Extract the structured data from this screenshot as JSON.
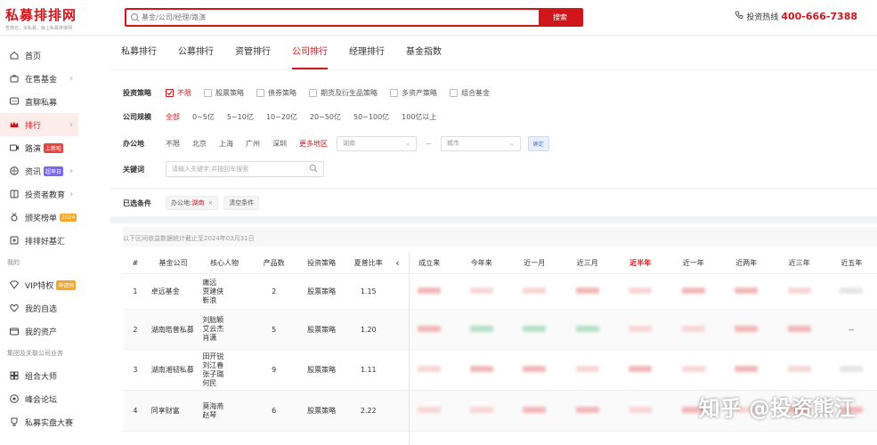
{
  "brand": {
    "title": "私募排排网",
    "subtitle": "查排名，买私募，就上私募排排网"
  },
  "search": {
    "placeholder": "基金/公司/经理/路演",
    "button": "搜索"
  },
  "hotline": {
    "label": "投资热线",
    "number": "400-666-7388"
  },
  "colors": {
    "accent": "#d0161b"
  },
  "sidebar": {
    "items": [
      {
        "label": "首页",
        "icon": "home-icon"
      },
      {
        "label": "在售基金",
        "icon": "bag-icon",
        "arrow": true
      },
      {
        "label": "直聊私募",
        "icon": "chat-icon"
      },
      {
        "label": "排行",
        "icon": "crown-icon",
        "arrow": true,
        "active": true
      },
      {
        "label": "路演",
        "icon": "video-icon",
        "tag": "上新啦",
        "tag_color": "#e64340"
      },
      {
        "label": "资讯",
        "icon": "news-icon",
        "tag": "超早日",
        "tag_color": "#7b68ee",
        "arrow": true
      },
      {
        "label": "投资者教育",
        "icon": "book-icon",
        "arrow": true
      },
      {
        "label": "颁奖榜单",
        "icon": "medal-icon",
        "tag": "2024",
        "tag_color": "#f5a623"
      },
      {
        "label": "排排好基汇",
        "icon": "star-icon"
      }
    ],
    "group_mine": "我的",
    "mine_items": [
      {
        "label": "VIP特权",
        "icon": "vip-icon",
        "tag": "申请码",
        "tag_color": "#f5a623"
      },
      {
        "label": "我的自选",
        "icon": "heart-icon"
      },
      {
        "label": "我的资产",
        "icon": "wallet-icon"
      }
    ],
    "group_company": "集团及关联公司业务",
    "company_items": [
      {
        "label": "组合大师",
        "icon": "grid-icon"
      },
      {
        "label": "峰会论坛",
        "icon": "forum-icon"
      },
      {
        "label": "私募实盘大赛",
        "icon": "trophy-icon"
      }
    ]
  },
  "tabs": [
    {
      "label": "私募排行"
    },
    {
      "label": "公募排行"
    },
    {
      "label": "资管排行"
    },
    {
      "label": "公司排行",
      "active": true
    },
    {
      "label": "经理排行"
    },
    {
      "label": "基金指数"
    }
  ],
  "filters": {
    "strategy": {
      "label": "投资策略",
      "options": [
        {
          "label": "不限",
          "checked": true
        },
        {
          "label": "股票策略"
        },
        {
          "label": "债券策略"
        },
        {
          "label": "期货及衍生品策略"
        },
        {
          "label": "多资产策略"
        },
        {
          "label": "组合基金"
        }
      ]
    },
    "scale": {
      "label": "公司规模",
      "options": [
        "全部",
        "0~5亿",
        "5~10亿",
        "10~20亿",
        "20~50亿",
        "50~100亿",
        "100亿以上"
      ],
      "selected": "全部"
    },
    "location": {
      "label": "办公地",
      "options": [
        "不限",
        "北京",
        "上海",
        "广州",
        "深圳"
      ],
      "more": "更多地区",
      "province": "湖南",
      "city_placeholder": "城市",
      "tilde": "~",
      "confirm": "确定"
    },
    "keyword": {
      "label": "关键词",
      "placeholder": "请输入关键字,并按回车搜索"
    }
  },
  "selected_conditions": {
    "label": "已选条件",
    "chip_key": "办公地:",
    "chip_value": "湖南",
    "clear": "清空条件"
  },
  "note": "以下区间收益数据统计截止至2024年03月31日",
  "table": {
    "headers": [
      "#",
      "基金公司",
      "核心人物",
      "产品数",
      "投资策略",
      "夏普比率",
      "成立来",
      "今年来",
      "近一月",
      "近三月",
      "近半年",
      "近一年",
      "近两年",
      "近三年",
      "近五年"
    ],
    "highlight_header": "近半年",
    "rows": [
      {
        "rank": "1",
        "company": "卓远基金",
        "people": [
          "庸远",
          "贾建侠",
          "靳浪"
        ],
        "products": "2",
        "strategy": "股票策略",
        "sharpe": "1.15"
      },
      {
        "rank": "2",
        "company": "湖南皓普私募",
        "people": [
          "刘朏颖",
          "艾云杰",
          "肖潇"
        ],
        "products": "5",
        "strategy": "股票策略",
        "sharpe": "1.20",
        "last": "--"
      },
      {
        "rank": "3",
        "company": "湖南湘韧私募",
        "people": [
          "田开锐",
          "刘江春",
          "张子璐",
          "何民"
        ],
        "products": "9",
        "strategy": "股票策略",
        "sharpe": "1.11"
      },
      {
        "rank": "4",
        "company": "同享财富",
        "people": [
          "莫海燕",
          "赵琴"
        ],
        "products": "6",
        "strategy": "股票策略",
        "sharpe": "2.22"
      }
    ]
  },
  "watermark": "知乎 @投资熊江"
}
